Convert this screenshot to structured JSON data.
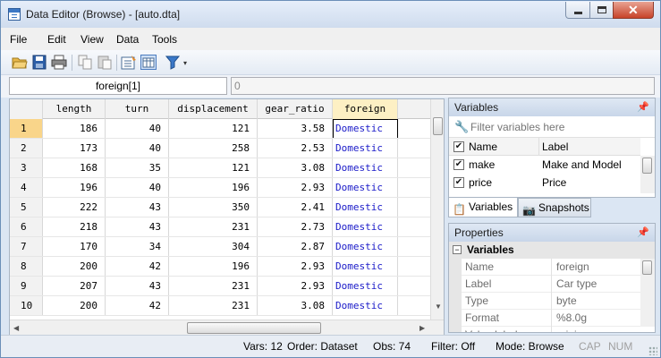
{
  "window": {
    "title": "Data Editor (Browse) - [auto.dta]"
  },
  "menu": [
    "File",
    "Edit",
    "View",
    "Data",
    "Tools"
  ],
  "toolbar": {
    "icons": [
      "open-icon",
      "save-icon",
      "print-icon",
      "copy-icon",
      "paste-icon",
      "variables-manager-icon",
      "data-editor-edit-icon",
      "filter-icon"
    ]
  },
  "varbar": {
    "varname": "foreign[1]",
    "value": "0"
  },
  "grid": {
    "columns": [
      "length",
      "turn",
      "displacement",
      "gear_ratio",
      "foreign"
    ],
    "rows": [
      {
        "n": "1",
        "length": "186",
        "turn": "40",
        "displacement": "121",
        "gear_ratio": "3.58",
        "foreign": "Domestic"
      },
      {
        "n": "2",
        "length": "173",
        "turn": "40",
        "displacement": "258",
        "gear_ratio": "2.53",
        "foreign": "Domestic"
      },
      {
        "n": "3",
        "length": "168",
        "turn": "35",
        "displacement": "121",
        "gear_ratio": "3.08",
        "foreign": "Domestic"
      },
      {
        "n": "4",
        "length": "196",
        "turn": "40",
        "displacement": "196",
        "gear_ratio": "2.93",
        "foreign": "Domestic"
      },
      {
        "n": "5",
        "length": "222",
        "turn": "43",
        "displacement": "350",
        "gear_ratio": "2.41",
        "foreign": "Domestic"
      },
      {
        "n": "6",
        "length": "218",
        "turn": "43",
        "displacement": "231",
        "gear_ratio": "2.73",
        "foreign": "Domestic"
      },
      {
        "n": "7",
        "length": "170",
        "turn": "34",
        "displacement": "304",
        "gear_ratio": "2.87",
        "foreign": "Domestic"
      },
      {
        "n": "8",
        "length": "200",
        "turn": "42",
        "displacement": "196",
        "gear_ratio": "2.93",
        "foreign": "Domestic"
      },
      {
        "n": "9",
        "length": "207",
        "turn": "43",
        "displacement": "231",
        "gear_ratio": "2.93",
        "foreign": "Domestic"
      },
      {
        "n": "10",
        "length": "200",
        "turn": "42",
        "displacement": "231",
        "gear_ratio": "3.08",
        "foreign": "Domestic"
      }
    ]
  },
  "variables_panel": {
    "title": "Variables",
    "filter_placeholder": "Filter variables here",
    "header": {
      "name": "Name",
      "label": "Label"
    },
    "items": [
      {
        "name": "make",
        "label": "Make and Model",
        "checked": true
      },
      {
        "name": "price",
        "label": "Price",
        "checked": true
      }
    ]
  },
  "tabs": {
    "variables": "Variables",
    "snapshots": "Snapshots"
  },
  "properties_panel": {
    "title": "Properties",
    "section": "Variables",
    "rows": [
      {
        "key": "Name",
        "value": "foreign"
      },
      {
        "key": "Label",
        "value": "Car type"
      },
      {
        "key": "Type",
        "value": "byte"
      },
      {
        "key": "Format",
        "value": "%8.0g"
      },
      {
        "key": "Value label",
        "value": "origin"
      }
    ]
  },
  "status": {
    "vars": "Vars: 12",
    "order": "Order: Dataset",
    "obs": "Obs: 74",
    "filter": "Filter: Off",
    "mode": "Mode: Browse",
    "cap": "CAP",
    "num": "NUM"
  },
  "colors": {
    "selected_column": "#fdf0c4",
    "selected_row": "#f9d58a",
    "string_text": "#1a1ac8"
  }
}
